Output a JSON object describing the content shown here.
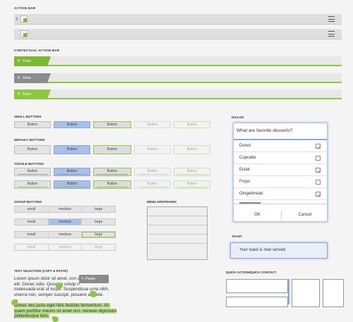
{
  "sections": {
    "action_bar": "ACTION BAR",
    "contextual_action_bar": "CONTEXTUAL ACTION BAR",
    "small_buttons": "SMALL BUTTONS",
    "default_buttons": "DEFAULT BUTTONS",
    "toggle_buttons": "TOGGLE BUTTONS",
    "group_buttons": "GROUP BUTTONS",
    "menu_dropdown": "MENU DROPDOWN",
    "dialog": "DIALOG",
    "toast": "TOAST",
    "text_selection": "TEXT SELECTION (COPY & PASTE)",
    "quick_action": "QUICK ACTION/QUICK CONTACT"
  },
  "action_bar": {
    "back_glyph": "‹"
  },
  "cab": {
    "done_label": "Done",
    "close_glyph": "✕",
    "colors": [
      "#7db834",
      "#8c8c8c",
      "#8dc63f"
    ]
  },
  "button_label": "Button",
  "groups": {
    "labels": [
      "small",
      "medium",
      "large"
    ]
  },
  "dialog": {
    "title": "What are favorite desserts?",
    "items": [
      {
        "label": "Donut",
        "checked": true
      },
      {
        "label": "Cupcake",
        "checked": false
      },
      {
        "label": "Eclair",
        "checked": true
      },
      {
        "label": "Froyo",
        "checked": false
      },
      {
        "label": "Gingerbread",
        "checked": true
      }
    ],
    "ok": "OK",
    "cancel": "Cancel"
  },
  "toast": {
    "message": "Your toast is now served"
  },
  "text_selection": {
    "para1_line1": "Lorem ipsum dolor sit amet, con          adipiscing",
    "para1_line2": "elit. Donec odio. Quisque volutp          n",
    "para1_line3": "malesuada erat ut turpis. Suspendisse urna nibh,",
    "para1_line4": "viverra non, semper suscipit, posuere a, pede.",
    "paste": "Paste",
    "para2_line1": "Donec nec justo eget felis facilisis fermentum. Ali-",
    "para2_line2": "quam porttitor mauris sit amet orci. Aenean dignissim",
    "para2_line3": "pellentesque felis."
  },
  "accent": "#8dc63f",
  "holo_blue": "#8ea7d6"
}
